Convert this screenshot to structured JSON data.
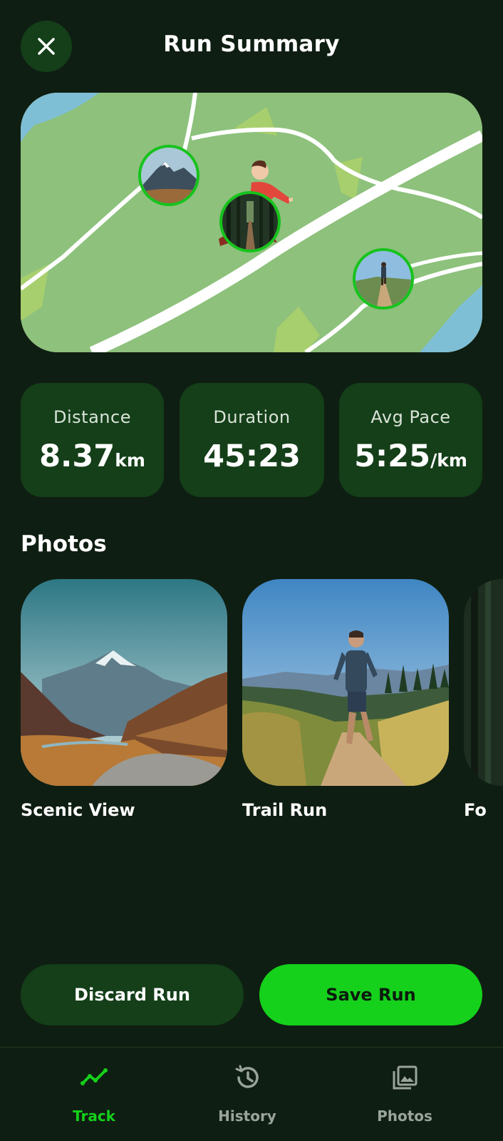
{
  "header": {
    "title": "Run Summary",
    "close_icon": "close-icon"
  },
  "map": {
    "pins": [
      {
        "name": "mountain-photo-pin",
        "icon": "mountain-thumbnail"
      },
      {
        "name": "forest-photo-pin",
        "icon": "forest-thumbnail"
      },
      {
        "name": "trail-photo-pin",
        "icon": "trail-runner-thumbnail"
      }
    ]
  },
  "stats": [
    {
      "label": "Distance",
      "value": "8.37",
      "unit": "km"
    },
    {
      "label": "Duration",
      "value": "45:23",
      "unit": ""
    },
    {
      "label": "Avg Pace",
      "value": "5:25",
      "unit": "/km"
    }
  ],
  "photos": {
    "title": "Photos",
    "items": [
      {
        "caption": "Scenic View"
      },
      {
        "caption": "Trail Run"
      },
      {
        "caption": "Fo"
      }
    ]
  },
  "actions": {
    "discard_label": "Discard Run",
    "save_label": "Save Run"
  },
  "nav": {
    "items": [
      {
        "label": "Track",
        "icon": "trend-line-icon",
        "active": true
      },
      {
        "label": "History",
        "icon": "history-icon",
        "active": false
      },
      {
        "label": "Photos",
        "icon": "photo-library-icon",
        "active": false
      }
    ]
  },
  "colors": {
    "background": "#0f1e12",
    "card": "#143f19",
    "accent": "#15d11b",
    "nav_inactive": "#9aa49b"
  }
}
